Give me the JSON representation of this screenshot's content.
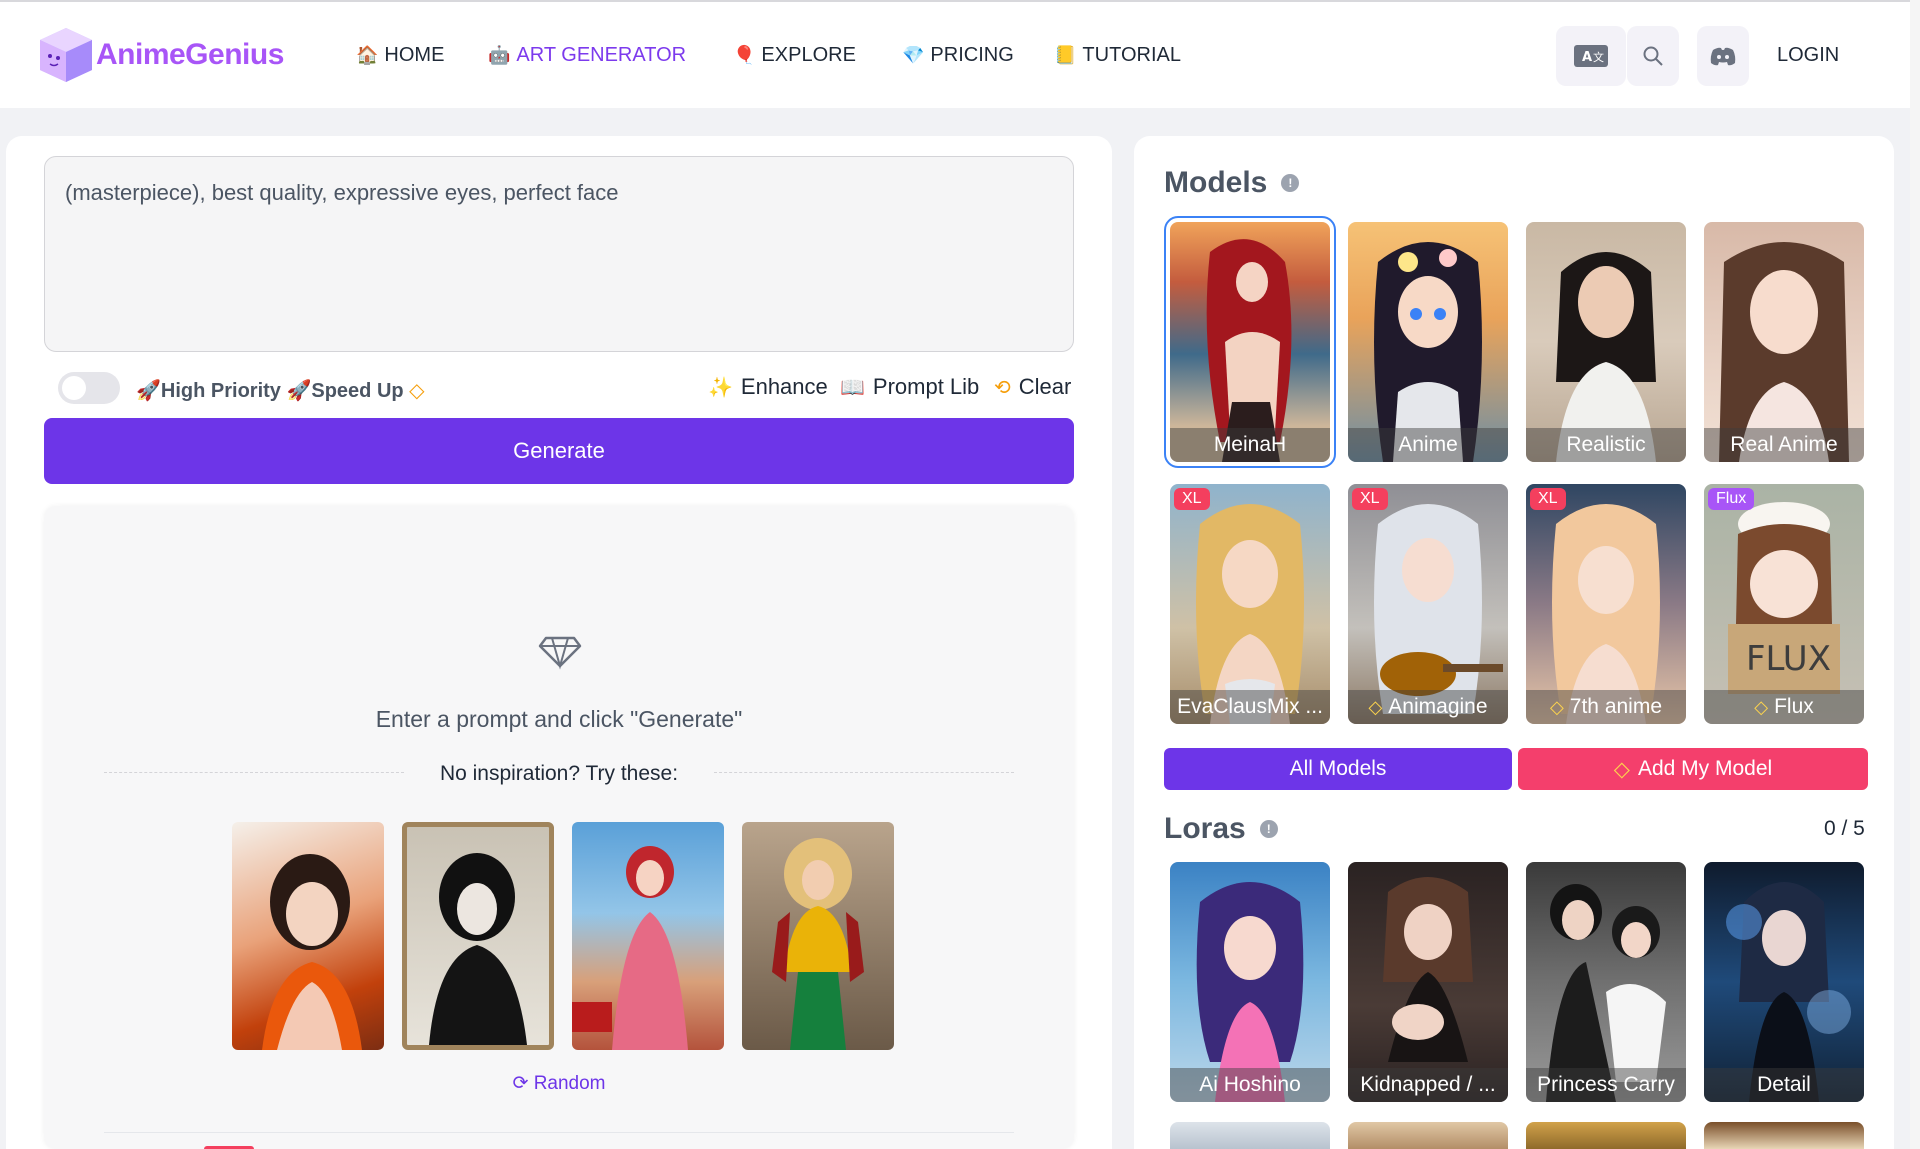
{
  "header": {
    "brand": "AnimeGenius",
    "nav": [
      {
        "icon": "🏠",
        "label": "HOME",
        "active": false
      },
      {
        "icon": "🤖",
        "label": "ART GENERATOR",
        "active": true
      },
      {
        "icon": "🎈",
        "label": "EXPLORE",
        "active": false
      },
      {
        "icon": "💎",
        "label": "PRICING",
        "active": false
      },
      {
        "icon": "📒",
        "label": "TUTORIAL",
        "active": false
      }
    ],
    "translate_icon": "translate-icon",
    "search_icon": "search-icon",
    "discord_icon": "discord-icon",
    "login_label": "LOGIN"
  },
  "generator": {
    "prompt_value": "(masterpiece), best quality, expressive eyes, perfect face",
    "priority_label": "🚀High Priority 🚀Speed Up",
    "enhance_label": "Enhance",
    "prompt_lib_label": "Prompt Lib",
    "clear_label": "Clear",
    "generate_label": "Generate",
    "empty_message": "Enter a prompt and click \"Generate\"",
    "inspiration_label": "No inspiration? Try these:",
    "random_label": "Random"
  },
  "models": {
    "title": "Models",
    "items": [
      {
        "label": "MeinaH",
        "badge": "",
        "premium": false,
        "selected": true
      },
      {
        "label": "Anime",
        "badge": "",
        "premium": false,
        "selected": false
      },
      {
        "label": "Realistic",
        "badge": "",
        "premium": false,
        "selected": false
      },
      {
        "label": "Real Anime",
        "badge": "",
        "premium": false,
        "selected": false
      },
      {
        "label": "EvaClausMix ...",
        "badge": "XL",
        "premium": false,
        "selected": false
      },
      {
        "label": "Animagine",
        "badge": "XL",
        "premium": true,
        "selected": false
      },
      {
        "label": "7th anime",
        "badge": "XL",
        "premium": true,
        "selected": false
      },
      {
        "label": "Flux",
        "badge": "Flux",
        "premium": true,
        "selected": false
      }
    ],
    "all_models_label": "All Models",
    "add_model_label": "Add My Model"
  },
  "loras": {
    "title": "Loras",
    "count": "0 / 5",
    "items": [
      {
        "label": "Ai Hoshino"
      },
      {
        "label": "Kidnapped / ..."
      },
      {
        "label": "Princess Carry"
      },
      {
        "label": "Detail"
      }
    ]
  },
  "colors": {
    "accent": "#6d35e8",
    "pink": "#f43f6c",
    "xl_badge": "#f43f5e",
    "flux_badge": "#a855f7"
  }
}
